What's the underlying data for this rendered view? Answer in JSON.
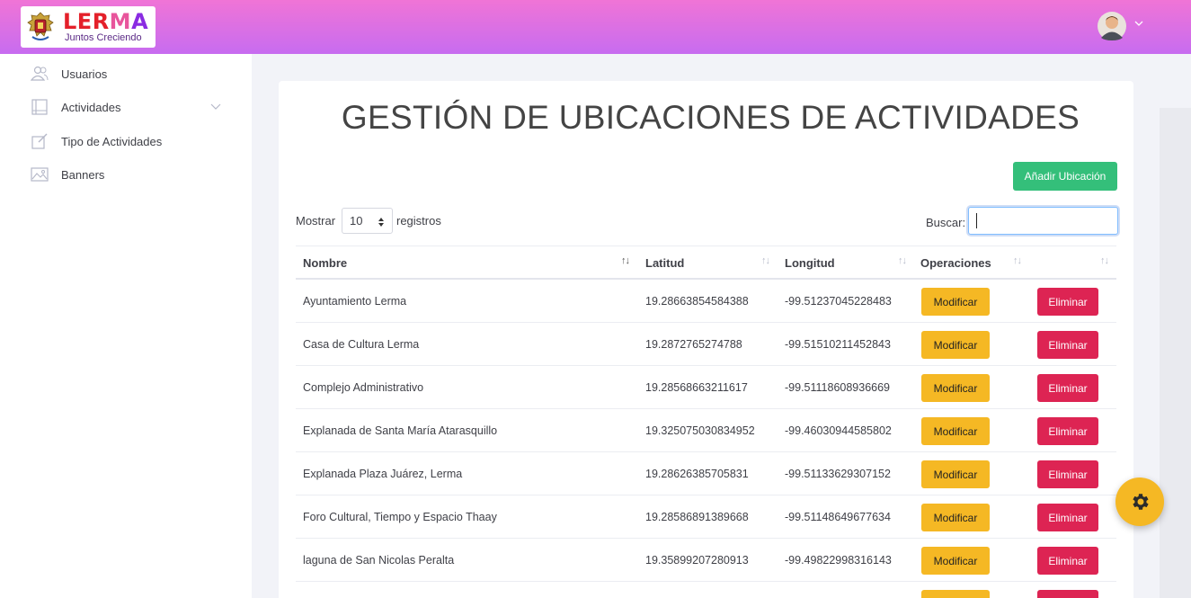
{
  "brand": {
    "title_parts": [
      "LER",
      "M",
      "A"
    ],
    "subtitle": "Juntos Creciendo",
    "colors": {
      "header_start": "#f074d6",
      "header_end": "#c76cf0"
    }
  },
  "header": {
    "user_icon": "user-avatar-icon",
    "menu_icon": "chevron-down-icon"
  },
  "sidebar": {
    "items": [
      {
        "label": "Usuarios",
        "icon": "users-icon"
      },
      {
        "label": "Actividades",
        "icon": "book-icon",
        "has_submenu": true
      },
      {
        "label": "Tipo de Actividades",
        "icon": "edit-icon"
      },
      {
        "label": "Banners",
        "icon": "image-icon"
      }
    ]
  },
  "page": {
    "title": "GESTIÓN DE UBICACIONES DE ACTIVIDADES",
    "add_button": "Añadir Ubicación",
    "length_label_before": "Mostrar",
    "length_value": "10",
    "length_label_after": "registros",
    "search_label": "Buscar:",
    "search_value": ""
  },
  "table": {
    "columns": [
      "Nombre",
      "Latitud",
      "Longitud",
      "Operaciones",
      ""
    ],
    "rows": [
      {
        "nombre": "Ayuntamiento Lerma",
        "latitud": "19.28663854584388",
        "longitud": "-99.51237045228483"
      },
      {
        "nombre": "Casa de Cultura Lerma",
        "latitud": "19.2872765274788",
        "longitud": "-99.51510211452843"
      },
      {
        "nombre": "Complejo Administrativo",
        "latitud": "19.28568663211617",
        "longitud": "-99.51118608936669"
      },
      {
        "nombre": "Explanada de Santa María Atarasquillo",
        "latitud": "19.325075030834952",
        "longitud": "-99.46030944585802"
      },
      {
        "nombre": "Explanada Plaza Juárez, Lerma",
        "latitud": "19.28626385705831",
        "longitud": "-99.51133629307152"
      },
      {
        "nombre": "Foro Cultural, Tiempo y Espacio Thaay",
        "latitud": "19.28586891389668",
        "longitud": "-99.51148649677634"
      },
      {
        "nombre": "laguna de San Nicolas Peralta",
        "latitud": "19.35899207280913",
        "longitud": "-99.49822998316143"
      }
    ],
    "modify_label": "Modificar",
    "delete_label": "Eliminar"
  },
  "fab": {
    "icon": "gear-icon",
    "color": "#f5b824"
  }
}
